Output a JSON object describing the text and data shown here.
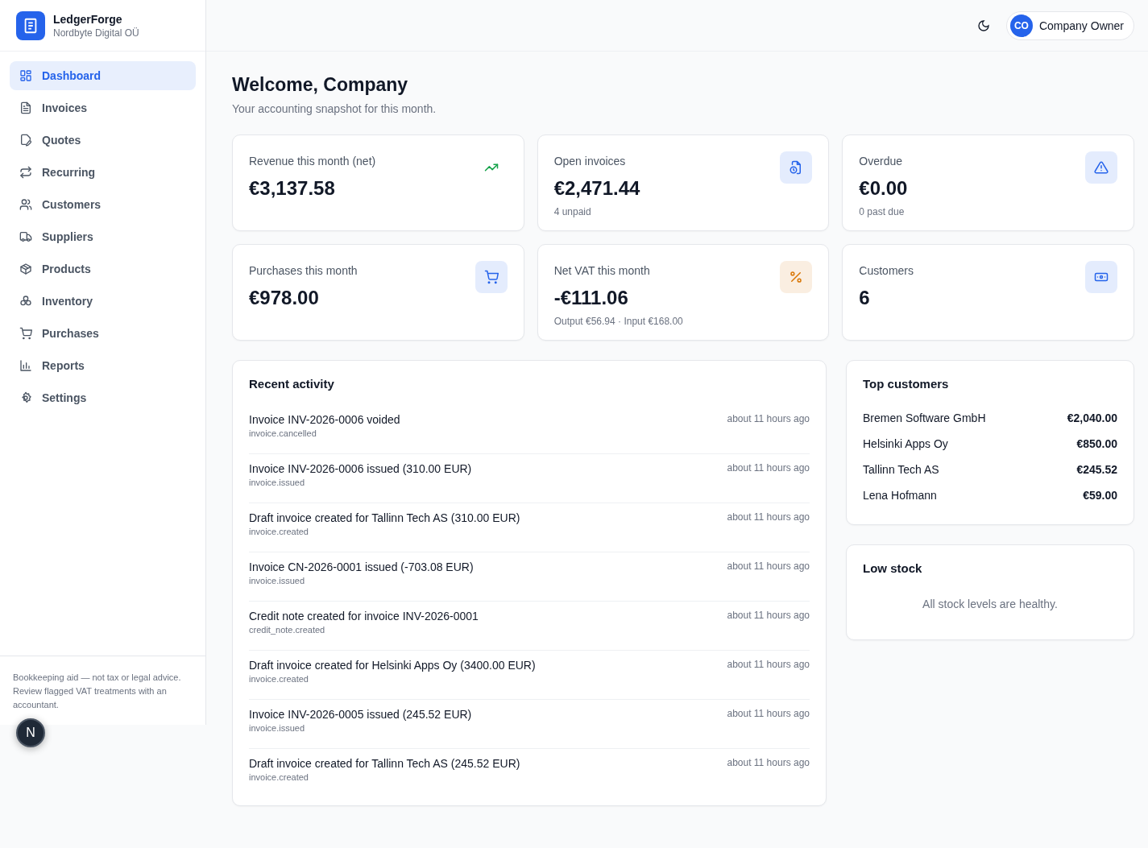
{
  "brand": {
    "name": "LedgerForge",
    "company": "Nordbyte Digital OÜ"
  },
  "sidebar": {
    "items": [
      {
        "label": "Dashboard",
        "selected": true
      },
      {
        "label": "Invoices",
        "selected": false
      },
      {
        "label": "Quotes",
        "selected": false
      },
      {
        "label": "Recurring",
        "selected": false
      },
      {
        "label": "Customers",
        "selected": false
      },
      {
        "label": "Suppliers",
        "selected": false
      },
      {
        "label": "Products",
        "selected": false
      },
      {
        "label": "Inventory",
        "selected": false
      },
      {
        "label": "Purchases",
        "selected": false
      },
      {
        "label": "Reports",
        "selected": false
      },
      {
        "label": "Settings",
        "selected": false
      }
    ],
    "disclaimer": "Bookkeeping aid — not tax or legal advice. Review flagged VAT treatments with an accountant.",
    "dev_badge": "N"
  },
  "header": {
    "user_initials": "CO",
    "user_name": "Company Owner"
  },
  "welcome": {
    "title": "Welcome, Company",
    "subtitle": "Your accounting snapshot for this month."
  },
  "stats": [
    {
      "label": "Revenue this month (net)",
      "value": "€3,137.58",
      "color": "#16a34a"
    },
    {
      "label": "Open invoices",
      "value": "€2,471.44",
      "note": "4 unpaid",
      "color": "#2563eb"
    },
    {
      "label": "Overdue",
      "value": "€0.00",
      "note": "0 past due",
      "color": "#2563eb"
    },
    {
      "label": "Purchases this month",
      "value": "€978.00",
      "color": "#2563eb"
    },
    {
      "label": "Net VAT this month",
      "value": "-€111.06",
      "note": "Output €56.94 · Input €168.00",
      "color": "#d97706"
    },
    {
      "label": "Customers",
      "value": "6",
      "color": "#2563eb"
    }
  ],
  "recent_activity": {
    "title": "Recent activity",
    "items": [
      {
        "text": "Invoice INV-2026-0006 voided",
        "event": "invoice.cancelled",
        "time": "about 11 hours ago"
      },
      {
        "text": "Invoice INV-2026-0006 issued (310.00 EUR)",
        "event": "invoice.issued",
        "time": "about 11 hours ago"
      },
      {
        "text": "Draft invoice created for Tallinn Tech AS (310.00 EUR)",
        "event": "invoice.created",
        "time": "about 11 hours ago"
      },
      {
        "text": "Invoice CN-2026-0001 issued (-703.08 EUR)",
        "event": "invoice.issued",
        "time": "about 11 hours ago"
      },
      {
        "text": "Credit note created for invoice INV-2026-0001",
        "event": "credit_note.created",
        "time": "about 11 hours ago"
      },
      {
        "text": "Draft invoice created for Helsinki Apps Oy (3400.00 EUR)",
        "event": "invoice.created",
        "time": "about 11 hours ago"
      },
      {
        "text": "Invoice INV-2026-0005 issued (245.52 EUR)",
        "event": "invoice.issued",
        "time": "about 11 hours ago"
      },
      {
        "text": "Draft invoice created for Tallinn Tech AS (245.52 EUR)",
        "event": "invoice.created",
        "time": "about 11 hours ago"
      }
    ]
  },
  "top_customers": {
    "title": "Top customers",
    "rows": [
      {
        "name": "Bremen Software GmbH",
        "amount": "€2,040.00"
      },
      {
        "name": "Helsinki Apps Oy",
        "amount": "€850.00"
      },
      {
        "name": "Tallinn Tech AS",
        "amount": "€245.52"
      },
      {
        "name": "Lena Hofmann",
        "amount": "€59.00"
      }
    ]
  },
  "low_stock": {
    "title": "Low stock",
    "message": "All stock levels are healthy."
  }
}
